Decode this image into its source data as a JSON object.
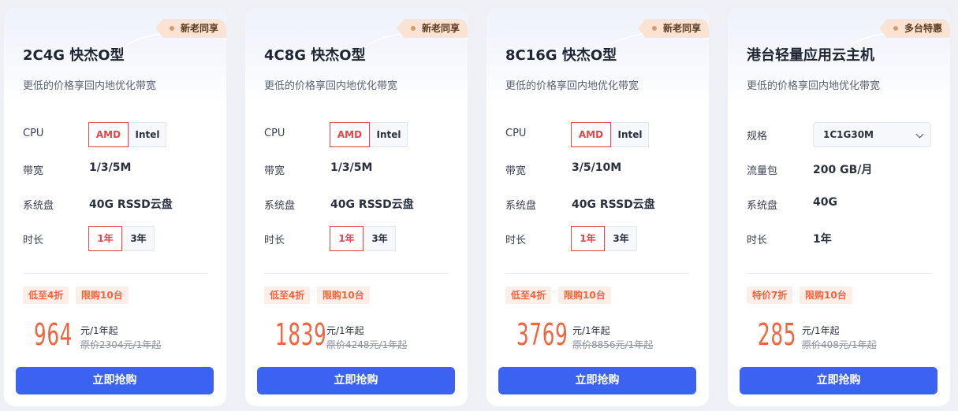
{
  "cards": [
    {
      "badge": "新老同享",
      "title": "2C4G 快杰O型",
      "subtitle": "更低的价格享回内地优化带宽",
      "rows": [
        {
          "label": "CPU",
          "options": [
            "AMD",
            "Intel"
          ],
          "selected": "AMD"
        },
        {
          "label": "带宽",
          "value": "1/3/5M"
        },
        {
          "label": "系统盘",
          "value": "40G RSSD云盘"
        },
        {
          "label": "时长",
          "options": [
            "1年",
            "3年"
          ],
          "selected": "1年"
        }
      ],
      "tags": [
        "低至4折",
        "限购10台"
      ],
      "price": "964",
      "unit": "元/1年起",
      "original": "原价2304元/1年起",
      "button": "立即抢购"
    },
    {
      "badge": "新老同享",
      "title": "4C8G 快杰O型",
      "subtitle": "更低的价格享回内地优化带宽",
      "rows": [
        {
          "label": "CPU",
          "options": [
            "AMD",
            "Intel"
          ],
          "selected": "AMD"
        },
        {
          "label": "带宽",
          "value": "1/3/5M"
        },
        {
          "label": "系统盘",
          "value": "40G RSSD云盘"
        },
        {
          "label": "时长",
          "options": [
            "1年",
            "3年"
          ],
          "selected": "1年"
        }
      ],
      "tags": [
        "低至4折",
        "限购10台"
      ],
      "price": "1839",
      "unit": "元/1年起",
      "original": "原价4248元/1年起",
      "button": "立即抢购"
    },
    {
      "badge": "新老同享",
      "title": "8C16G 快杰O型",
      "subtitle": "更低的价格享回内地优化带宽",
      "rows": [
        {
          "label": "CPU",
          "options": [
            "AMD",
            "Intel"
          ],
          "selected": "AMD"
        },
        {
          "label": "带宽",
          "value": "3/5/10M"
        },
        {
          "label": "系统盘",
          "value": "40G RSSD云盘"
        },
        {
          "label": "时长",
          "options": [
            "1年",
            "3年"
          ],
          "selected": "1年"
        }
      ],
      "tags": [
        "低至4折",
        "限购10台"
      ],
      "price": "3769",
      "unit": "元/1年起",
      "original": "原价8856元/1年起",
      "button": "立即抢购"
    },
    {
      "badge": "多台特惠",
      "title": "港台轻量应用云主机",
      "subtitle": "更低的价格享回内地优化带宽",
      "rows": [
        {
          "label": "规格",
          "select": "1C1G30M"
        },
        {
          "label": "流量包",
          "value": "200 GB/月"
        },
        {
          "label": "系统盘",
          "value": "40G"
        },
        {
          "label": "时长",
          "value": "1年"
        }
      ],
      "tags": [
        "特价7折",
        "限购10台"
      ],
      "price": "285",
      "unit": "元/1年起",
      "original": "原价408元/1年起",
      "button": "立即抢购"
    }
  ],
  "colors": {
    "accent": "#f0653f",
    "button": "#3b62f1",
    "selected_border": "#e0464a",
    "badge_bg": "#fbe3d3"
  }
}
